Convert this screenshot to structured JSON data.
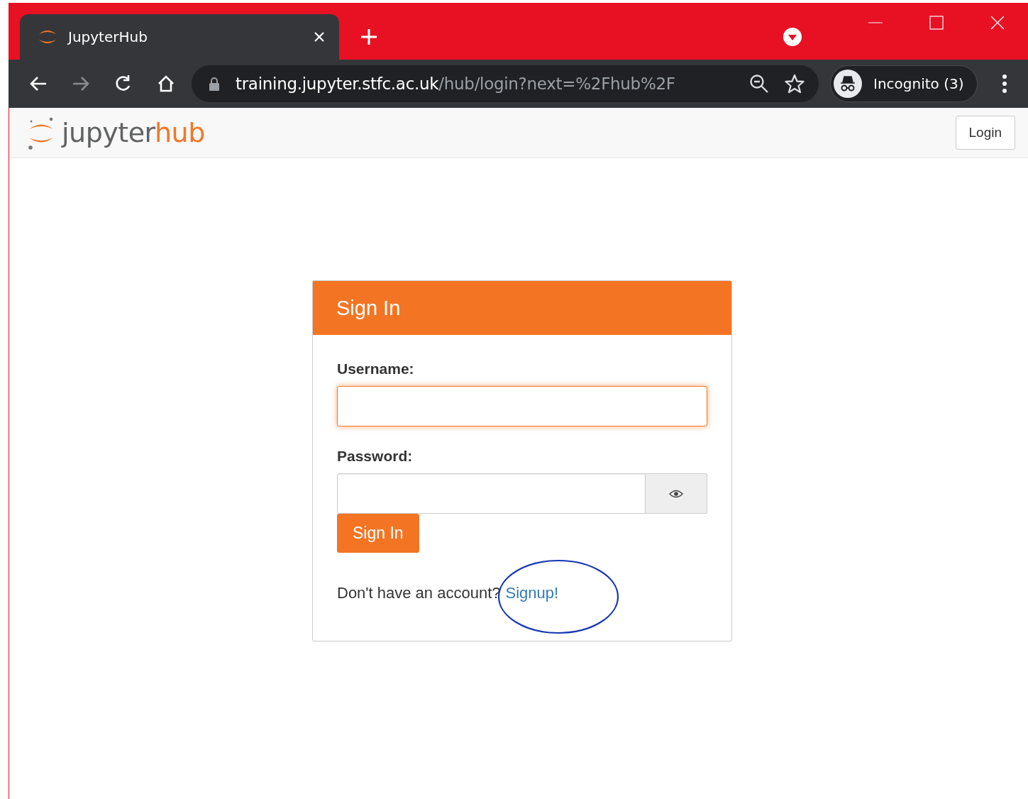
{
  "browser": {
    "tab": {
      "title": "JupyterHub"
    },
    "nav_buttons": [
      {
        "kind": "back",
        "disabled": false
      },
      {
        "kind": "forward",
        "disabled": true
      },
      {
        "kind": "reload",
        "disabled": false
      },
      {
        "kind": "home",
        "disabled": false
      }
    ],
    "address": {
      "host": "training.jupyter.stfc.ac.uk",
      "path": "/hub/login?next=%2Fhub%2F"
    },
    "profile": {
      "label": "Incognito (3)"
    }
  },
  "navbar": {
    "logo": {
      "part_1": "jupyter",
      "part_2": "hub"
    },
    "login_button": "Login"
  },
  "card": {
    "title": "Sign In",
    "fields": [
      {
        "kind": "text",
        "label": "Username:",
        "focused": true
      },
      {
        "kind": "password",
        "label": "Password:",
        "focused": false
      }
    ],
    "submit": "Sign In",
    "signup": {
      "prompt": "Don't have an account?",
      "link": "Signup!"
    }
  }
}
